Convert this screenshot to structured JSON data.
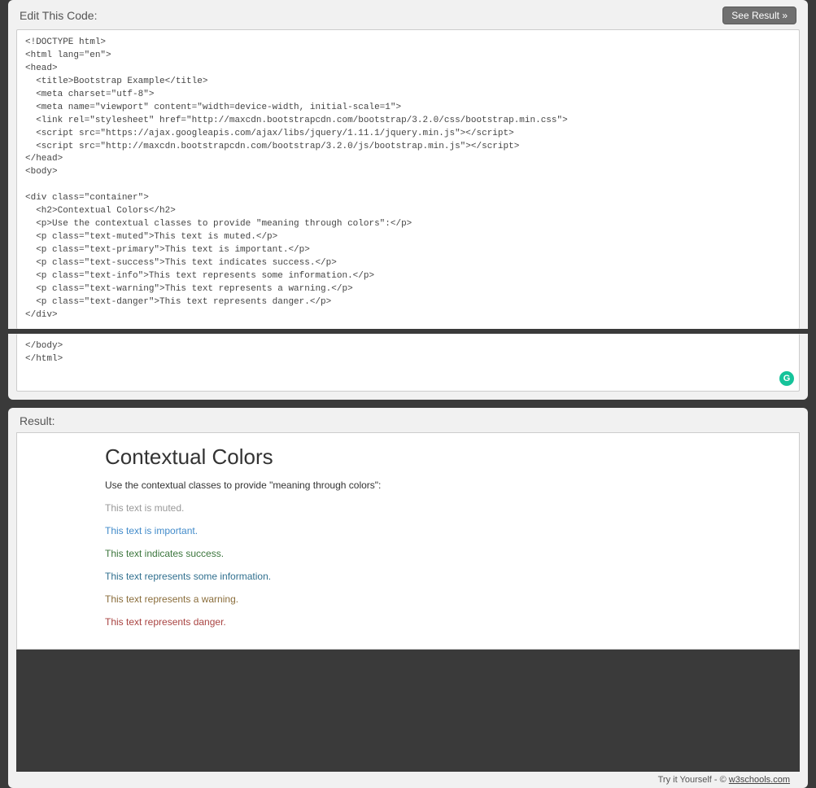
{
  "editHeader": {
    "title": "Edit This Code:",
    "buttonLabel": "See Result »"
  },
  "codeUpper": "<!DOCTYPE html>\n<html lang=\"en\">\n<head>\n  <title>Bootstrap Example</title>\n  <meta charset=\"utf-8\">\n  <meta name=\"viewport\" content=\"width=device-width, initial-scale=1\">\n  <link rel=\"stylesheet\" href=\"http://maxcdn.bootstrapcdn.com/bootstrap/3.2.0/css/bootstrap.min.css\">\n  <script src=\"https://ajax.googleapis.com/ajax/libs/jquery/1.11.1/jquery.min.js\"></script>\n  <script src=\"http://maxcdn.bootstrapcdn.com/bootstrap/3.2.0/js/bootstrap.min.js\"></script>\n</head>\n<body>\n\n<div class=\"container\">\n  <h2>Contextual Colors</h2>\n  <p>Use the contextual classes to provide \"meaning through colors\":</p>\n  <p class=\"text-muted\">This text is muted.</p>\n  <p class=\"text-primary\">This text is important.</p>\n  <p class=\"text-success\">This text indicates success.</p>\n  <p class=\"text-info\">This text represents some information.</p>\n  <p class=\"text-warning\">This text represents a warning.</p>\n  <p class=\"text-danger\">This text represents danger.</p>\n</div>",
  "codeLower": "</body>\n</html>",
  "resultHeader": "Result:",
  "result": {
    "heading": "Contextual Colors",
    "intro": "Use the contextual classes to provide \"meaning through colors\":",
    "lines": {
      "muted": "This text is muted.",
      "primary": "This text is important.",
      "success": "This text indicates success.",
      "info": "This text represents some information.",
      "warning": "This text represents a warning.",
      "danger": "This text represents danger."
    }
  },
  "footer": {
    "prefix": "Try it Yourself - © ",
    "linkText": "w3schools.com"
  },
  "grammarlyBadge": "G"
}
